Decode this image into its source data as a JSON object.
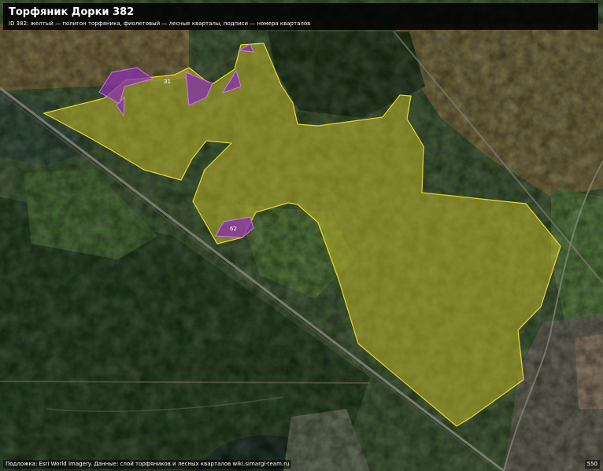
{
  "map": {
    "title": "Торфяник Дорки 382",
    "subtitle": "ID 382: желтый — полигон торфяника, фиолетовый — лесные кварталы, подписи — номера кварталов",
    "attribution": "Подложка: Esri World Imagery. Данные: слой торфяников и лесных кварталов wiki.simargl-team.ru",
    "scale_label": "550",
    "basemap": "satellite-imagery",
    "colors": {
      "peatland_fill": "#c9c02a",
      "peatland_stroke": "#e6d82c",
      "forest_quarter_fill": "#8a2fb0",
      "forest_quarter_stroke": "#c77ae8",
      "header_bg": "#000000"
    },
    "quarter_labels": [
      "31",
      "62"
    ]
  }
}
